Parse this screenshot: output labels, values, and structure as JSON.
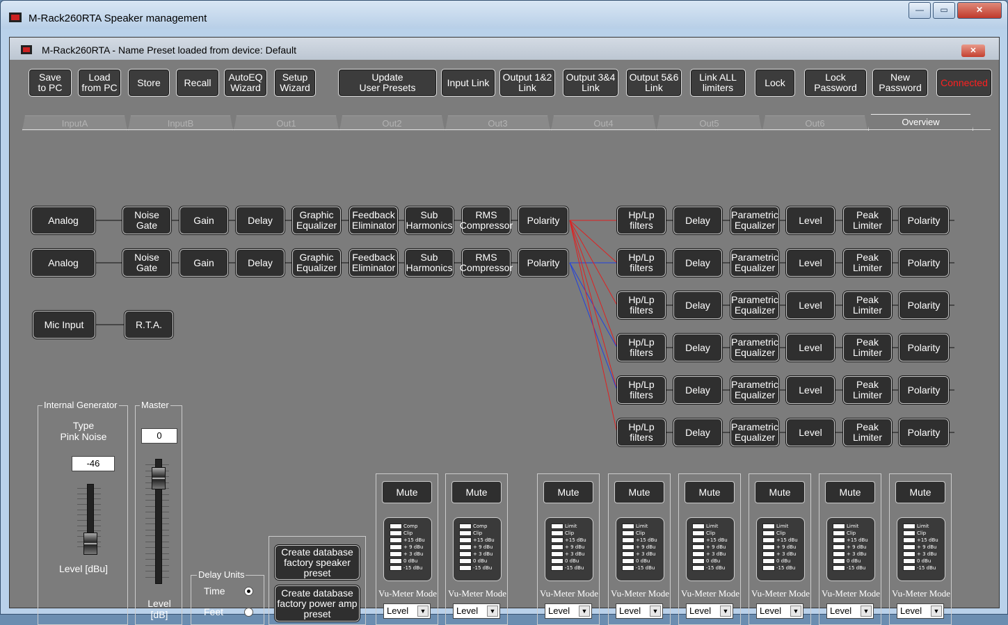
{
  "window": {
    "title": "M-Rack260RTA  Speaker management",
    "minimize": "—",
    "maximize": "▭",
    "close": "✕"
  },
  "inner": {
    "title": "M-Rack260RTA - Name Preset loaded from device: Default",
    "close": "✕"
  },
  "toolbar": [
    {
      "name": "save-to-pc-button",
      "label": "Save\nto PC"
    },
    {
      "name": "load-from-pc-button",
      "label": "Load\nfrom PC"
    },
    {
      "name": "store-button",
      "label": "Store"
    },
    {
      "name": "recall-button",
      "label": "Recall"
    },
    {
      "name": "autoeq-wizard-button",
      "label": "AutoEQ\nWizard"
    },
    {
      "name": "setup-wizard-button",
      "label": "Setup\nWizard"
    },
    {
      "name": "update-user-presets-button",
      "label": "Update\nUser Presets"
    },
    {
      "name": "input-link-button",
      "label": "Input Link"
    },
    {
      "name": "output-12-link-button",
      "label": "Output 1&2\nLink"
    },
    {
      "name": "output-34-link-button",
      "label": "Output 3&4\nLink"
    },
    {
      "name": "output-56-link-button",
      "label": "Output 5&6\nLink"
    },
    {
      "name": "link-all-limiters-button",
      "label": "Link ALL\nlimiters"
    },
    {
      "name": "lock-button",
      "label": "Lock"
    },
    {
      "name": "lock-password-button",
      "label": "Lock\nPassword"
    },
    {
      "name": "new-password-button",
      "label": "New\nPassword"
    },
    {
      "name": "connected-button",
      "label": "Connected"
    }
  ],
  "tabs": [
    "InputA",
    "InputB",
    "Out1",
    "Out2",
    "Out3",
    "Out4",
    "Out5",
    "Out6",
    "Overview"
  ],
  "active_tab": "Overview",
  "inputs": [
    {
      "source": "Analog",
      "chain": [
        "Noise Gate",
        "Gain",
        "Delay",
        "Graphic\nEqualizer",
        "Feedback\nEliminator",
        "Sub\nHarmonics",
        "RMS\nCompressor",
        "Polarity"
      ]
    },
    {
      "source": "Analog",
      "chain": [
        "Noise Gate",
        "Gain",
        "Delay",
        "Graphic\nEqualizer",
        "Feedback\nEliminator",
        "Sub\nHarmonics",
        "RMS\nCompressor",
        "Polarity"
      ]
    }
  ],
  "mic": {
    "source": "Mic Input",
    "rta": "R.T.A."
  },
  "outputs": [
    [
      "Hp/Lp\nfilters",
      "Delay",
      "Parametric\nEqualizer",
      "Level",
      "Peak\nLimiter",
      "Polarity"
    ],
    [
      "Hp/Lp\nfilters",
      "Delay",
      "Parametric\nEqualizer",
      "Level",
      "Peak\nLimiter",
      "Polarity"
    ],
    [
      "Hp/Lp\nfilters",
      "Delay",
      "Parametric\nEqualizer",
      "Level",
      "Peak\nLimiter",
      "Polarity"
    ],
    [
      "Hp/Lp\nfilters",
      "Delay",
      "Parametric\nEqualizer",
      "Level",
      "Peak\nLimiter",
      "Polarity"
    ],
    [
      "Hp/Lp\nfilters",
      "Delay",
      "Parametric\nEqualizer",
      "Level",
      "Peak\nLimiter",
      "Polarity"
    ],
    [
      "Hp/Lp\nfilters",
      "Delay",
      "Parametric\nEqualizer",
      "Level",
      "Peak\nLimiter",
      "Polarity"
    ]
  ],
  "routing_colors": {
    "inputA": "#e02020",
    "inputB": "#2040e0"
  },
  "generator": {
    "title": "Internal Generator",
    "type_label": "Type\nPink Noise",
    "value": "-46",
    "level_label": "Level [dBu]"
  },
  "master": {
    "title": "Master",
    "value": "0",
    "level_label": "Level\n[dB]"
  },
  "delay_units": {
    "title": "Delay Units",
    "time": "Time",
    "feet": "Feet",
    "selected": "Time"
  },
  "factory": {
    "speaker": "Create database\nfactory speaker\npreset",
    "poweramp": "Create database\nfactory power amp\npreset"
  },
  "channels": [
    {
      "type": "input",
      "mute": "Mute",
      "top": "Comp",
      "labels": [
        "Comp",
        "Clip",
        "+15 dBu",
        "+ 9 dBu",
        "+ 3 dBu",
        "  0 dBu",
        "-15 dBu"
      ],
      "mode_label": "Vu-Meter Mode",
      "mode": "Level"
    },
    {
      "type": "input",
      "mute": "Mute",
      "top": "Comp",
      "labels": [
        "Comp",
        "Clip",
        "+15 dBu",
        "+ 9 dBu",
        "+ 3 dBu",
        "  0 dBu",
        "-15 dBu"
      ],
      "mode_label": "Vu-Meter Mode",
      "mode": "Level"
    },
    {
      "type": "output",
      "mute": "Mute",
      "labels": [
        "Limit",
        "Clip",
        "+15 dBu",
        "+ 9 dBu",
        "+ 3 dBu",
        "  0 dBu",
        "-15 dBu"
      ],
      "mode_label": "Vu-Meter Mode",
      "mode": "Level"
    },
    {
      "type": "output",
      "mute": "Mute",
      "labels": [
        "Limit",
        "Clip",
        "+15 dBu",
        "+ 9 dBu",
        "+ 3 dBu",
        "  0 dBu",
        "-15 dBu"
      ],
      "mode_label": "Vu-Meter Mode",
      "mode": "Level"
    },
    {
      "type": "output",
      "mute": "Mute",
      "labels": [
        "Limit",
        "Clip",
        "+15 dBu",
        "+ 9 dBu",
        "+ 3 dBu",
        "  0 dBu",
        "-15 dBu"
      ],
      "mode_label": "Vu-Meter Mode",
      "mode": "Level"
    },
    {
      "type": "output",
      "mute": "Mute",
      "labels": [
        "Limit",
        "Clip",
        "+15 dBu",
        "+ 9 dBu",
        "+ 3 dBu",
        "  0 dBu",
        "-15 dBu"
      ],
      "mode_label": "Vu-Meter Mode",
      "mode": "Level"
    },
    {
      "type": "output",
      "mute": "Mute",
      "labels": [
        "Limit",
        "Clip",
        "+15 dBu",
        "+ 9 dBu",
        "+ 3 dBu",
        "  0 dBu",
        "-15 dBu"
      ],
      "mode_label": "Vu-Meter Mode",
      "mode": "Level"
    },
    {
      "type": "output",
      "mute": "Mute",
      "labels": [
        "Limit",
        "Clip",
        "+15 dBu",
        "+ 9 dBu",
        "+ 3 dBu",
        "  0 dBu",
        "-15 dBu"
      ],
      "mode_label": "Vu-Meter Mode",
      "mode": "Level"
    }
  ]
}
